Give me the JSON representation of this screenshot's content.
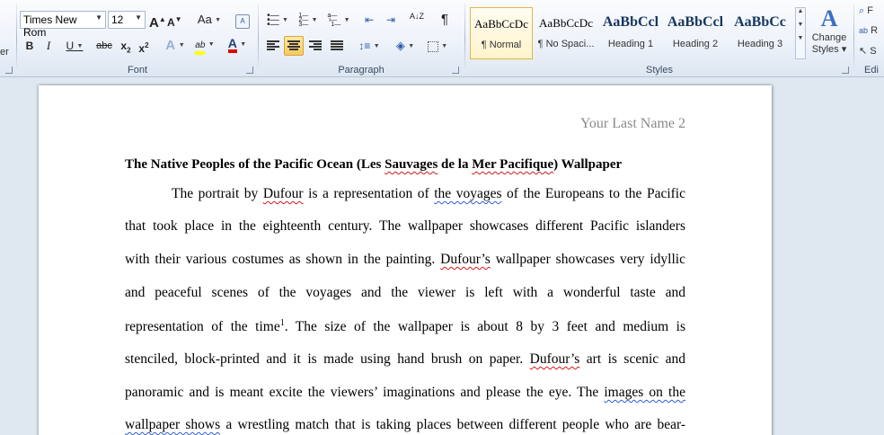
{
  "font": {
    "name": "Times New Rom",
    "size": "12",
    "grow_label": "A",
    "shrink_label": "A",
    "case_label": "Aa",
    "bold": "B",
    "italic": "I",
    "underline": "U",
    "strike": "abc",
    "subscript": "x",
    "superscript": "x",
    "text_effects": "A",
    "highlight": "ab",
    "font_color": "A",
    "group_label": "Font",
    "clear_label": "A"
  },
  "left_cut": {
    "text": "er"
  },
  "paragraph": {
    "group_label": "Paragraph",
    "show_marks": "¶",
    "sort": "A↓Z"
  },
  "styles": {
    "group_label": "Styles",
    "items": [
      {
        "sample": "AaBbCcDc",
        "name": "¶ Normal"
      },
      {
        "sample": "AaBbCcDc",
        "name": "¶ No Spaci..."
      },
      {
        "sample": "AaBbCcl",
        "name": "Heading 1"
      },
      {
        "sample": "AaBbCcl",
        "name": "Heading 2"
      },
      {
        "sample": "AaBbCc",
        "name": "Heading 3"
      }
    ],
    "change_styles_line1": "Change",
    "change_styles_line2": "Styles ▾"
  },
  "editing": {
    "group_label": "Edi",
    "find": "F",
    "replace": "R",
    "select": "S"
  },
  "document": {
    "running_head": "Your Last Name 2",
    "title_parts": [
      "The Native Peoples of the Pacific Ocean (Les ",
      "Sauvages",
      " de la ",
      "Mer Pacifique",
      ") Wallpaper"
    ],
    "lines": [
      {
        "parts": [
          "The portrait by ",
          "Dufour",
          " is a representation of ",
          "the  voyages",
          " of the Europeans to the Pacific"
        ]
      },
      {
        "parts": [
          "that took place in the eighteenth century. The wallpaper showcases different Pacific islanders"
        ]
      },
      {
        "parts": [
          "with their various costumes as shown in the painting. ",
          "Dufour’s",
          " wallpaper showcases very idyllic"
        ]
      },
      {
        "parts": [
          "and peaceful scenes of the voyages and the viewer is left with a wonderful taste and"
        ]
      },
      {
        "parts": [
          "representation of the time",
          "1",
          ". The size of the wallpaper is about 8 by 3 feet and medium is"
        ]
      },
      {
        "parts": [
          "stenciled, block-printed and it is made using hand brush on paper.  ",
          "Dufour’s",
          " art is scenic and"
        ]
      },
      {
        "parts": [
          "panoramic and is meant excite the viewers’ imaginations and please the eye. The ",
          "images on the"
        ]
      },
      {
        "parts": [
          "wallpaper shows",
          " a wrestling match that is taking places between different people who are bear-"
        ]
      }
    ]
  },
  "colors": {
    "spell_error": "#d01a1a",
    "grammar_error": "#2f5fc9",
    "highlight_yellow": "#ffff00",
    "font_color_red": "#e00000",
    "active_button": "#f8c95c"
  }
}
